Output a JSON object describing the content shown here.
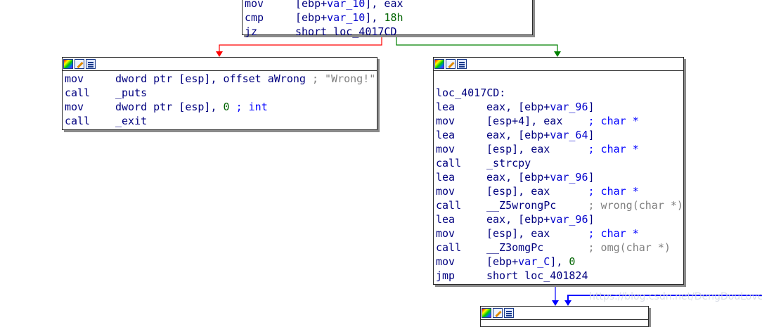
{
  "top_block": {
    "lines": [
      {
        "mn": "mov",
        "parts": [
          {
            "t": "[ebp+",
            "c": "op"
          },
          {
            "t": "var_10",
            "c": "var"
          },
          {
            "t": "], eax",
            "c": "op"
          }
        ]
      },
      {
        "mn": "cmp",
        "parts": [
          {
            "t": "[ebp+",
            "c": "op"
          },
          {
            "t": "var_10",
            "c": "var"
          },
          {
            "t": "], ",
            "c": "op"
          },
          {
            "t": "18h",
            "c": "num"
          }
        ]
      },
      {
        "mn": "jz",
        "parts": [
          {
            "t": "short loc_4017CD",
            "c": "op"
          }
        ]
      }
    ]
  },
  "left_block": {
    "lines": [
      {
        "mn": "mov",
        "parts": [
          {
            "t": "dword ptr [esp], offset aWrong",
            "c": "op"
          },
          {
            "t": " ; \"Wrong!\"",
            "c": "str"
          }
        ]
      },
      {
        "mn": "call",
        "parts": [
          {
            "t": "_puts",
            "c": "op"
          }
        ]
      },
      {
        "mn": "mov",
        "parts": [
          {
            "t": "dword ptr [esp], ",
            "c": "op"
          },
          {
            "t": "0",
            "c": "num"
          },
          {
            "t": " ; int",
            "c": "cm"
          }
        ]
      },
      {
        "mn": "call",
        "parts": [
          {
            "t": "_exit",
            "c": "op"
          }
        ]
      }
    ]
  },
  "right_block": {
    "label": "loc_4017CD:",
    "lines": [
      {
        "mn": "lea",
        "parts": [
          {
            "t": "eax, [ebp+",
            "c": "op"
          },
          {
            "t": "var_96",
            "c": "var"
          },
          {
            "t": "]",
            "c": "op"
          }
        ]
      },
      {
        "mn": "mov",
        "parts": [
          {
            "t": "[esp+4], eax    ",
            "c": "op"
          },
          {
            "t": "; char *",
            "c": "cm"
          }
        ]
      },
      {
        "mn": "lea",
        "parts": [
          {
            "t": "eax, [ebp+",
            "c": "op"
          },
          {
            "t": "var_64",
            "c": "var"
          },
          {
            "t": "]",
            "c": "op"
          }
        ]
      },
      {
        "mn": "mov",
        "parts": [
          {
            "t": "[esp], eax      ",
            "c": "op"
          },
          {
            "t": "; char *",
            "c": "cm"
          }
        ]
      },
      {
        "mn": "call",
        "parts": [
          {
            "t": "_strcpy",
            "c": "op"
          }
        ]
      },
      {
        "mn": "lea",
        "parts": [
          {
            "t": "eax, [ebp+",
            "c": "op"
          },
          {
            "t": "var_96",
            "c": "var"
          },
          {
            "t": "]",
            "c": "op"
          }
        ]
      },
      {
        "mn": "mov",
        "parts": [
          {
            "t": "[esp], eax      ",
            "c": "op"
          },
          {
            "t": "; char *",
            "c": "cm"
          }
        ]
      },
      {
        "mn": "call",
        "parts": [
          {
            "t": "__Z5wrongPc     ",
            "c": "op"
          },
          {
            "t": "; wrong(char *)",
            "c": "cmg"
          }
        ]
      },
      {
        "mn": "lea",
        "parts": [
          {
            "t": "eax, [ebp+",
            "c": "op"
          },
          {
            "t": "var_96",
            "c": "var"
          },
          {
            "t": "]",
            "c": "op"
          }
        ]
      },
      {
        "mn": "mov",
        "parts": [
          {
            "t": "[esp], eax      ",
            "c": "op"
          },
          {
            "t": "; char *",
            "c": "cm"
          }
        ]
      },
      {
        "mn": "call",
        "parts": [
          {
            "t": "__Z3omgPc       ",
            "c": "op"
          },
          {
            "t": "; omg(char *)",
            "c": "cmg"
          }
        ]
      },
      {
        "mn": "mov",
        "parts": [
          {
            "t": "[ebp+",
            "c": "op"
          },
          {
            "t": "var_C",
            "c": "var"
          },
          {
            "t": "], ",
            "c": "op"
          },
          {
            "t": "0",
            "c": "num"
          }
        ]
      },
      {
        "mn": "jmp",
        "parts": [
          {
            "t": "short loc_401824",
            "c": "op"
          }
        ]
      }
    ]
  },
  "header_icons": [
    "color-palette-icon",
    "edit-pencil-icon",
    "graph-view-icon"
  ],
  "edge_colors": {
    "false_branch": "#ff0000",
    "true_branch": "#008000",
    "jump": "#0000ff"
  },
  "watermark": "https://blog.csdn.net/DengDouLove"
}
